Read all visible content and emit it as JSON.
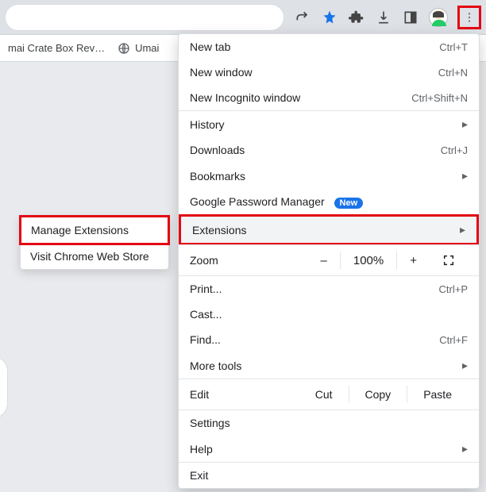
{
  "bookmarks": [
    {
      "label": "mai Crate Box Rev…"
    },
    {
      "label": "Umai"
    }
  ],
  "submenu": {
    "items": [
      {
        "label": "Manage Extensions",
        "highlighted": true
      },
      {
        "label": "Visit Chrome Web Store"
      }
    ]
  },
  "mainmenu": {
    "rows": [
      {
        "label": "New tab",
        "shortcut": "Ctrl+T"
      },
      {
        "label": "New window",
        "shortcut": "Ctrl+N"
      },
      {
        "label": "New Incognito window",
        "shortcut": "Ctrl+Shift+N"
      },
      {
        "label": "History",
        "arrow": true
      },
      {
        "label": "Downloads",
        "shortcut": "Ctrl+J"
      },
      {
        "label": "Bookmarks",
        "arrow": true
      },
      {
        "label": "Google Password Manager",
        "new_badge": "New"
      },
      {
        "label": "Extensions",
        "arrow": true,
        "highlighted": true
      },
      {
        "label": "Zoom",
        "type": "zoom"
      },
      {
        "label": "Print...",
        "shortcut": "Ctrl+P"
      },
      {
        "label": "Cast..."
      },
      {
        "label": "Find...",
        "shortcut": "Ctrl+F"
      },
      {
        "label": "More tools",
        "arrow": true
      },
      {
        "label": "Edit",
        "type": "edit"
      },
      {
        "label": "Settings"
      },
      {
        "label": "Help",
        "arrow": true
      },
      {
        "label": "Exit"
      }
    ],
    "zoom": {
      "minus": "–",
      "value": "100%",
      "plus": "+"
    },
    "edit": {
      "cut": "Cut",
      "copy": "Copy",
      "paste": "Paste"
    }
  }
}
